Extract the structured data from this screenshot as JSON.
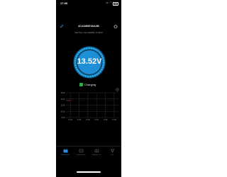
{
  "status_bar": {
    "time": "17:06",
    "icons": "▪▪ ◠"
  },
  "header": {
    "device_id": "4C2A8BE06A3B"
  },
  "test_time": "Test Time : Dec 04/2023, 17:09:10",
  "voltage": "13.52V",
  "status_label": "Charging",
  "chart_data": {
    "type": "line",
    "title": "",
    "xlabel": "",
    "ylabel": "",
    "x": [
      "17:04",
      "17:05",
      "17:06",
      "17:07",
      "17:08",
      "17:09"
    ],
    "yticks": [
      "16.00",
      "14.00",
      "12.00",
      "10.00",
      "8.00"
    ],
    "ylim": [
      8,
      16
    ],
    "threshold": 13.5,
    "colors": {
      "grid": "#3a3a3a",
      "line": "#c2412f",
      "threshold": "#c2412f"
    }
  },
  "tabs": [
    {
      "label": "Battery Test",
      "icon": "battery-icon",
      "active": true
    },
    {
      "label": "Cranking Test",
      "icon": "cranking-icon",
      "active": false
    },
    {
      "label": "Charging Test",
      "icon": "charging-icon",
      "active": false
    },
    {
      "label": "Trip",
      "icon": "trip-icon",
      "active": false
    }
  ],
  "colors": {
    "accent": "#2a8fe0",
    "ring": "#1fa8f2",
    "charging": "#2fa84f"
  }
}
